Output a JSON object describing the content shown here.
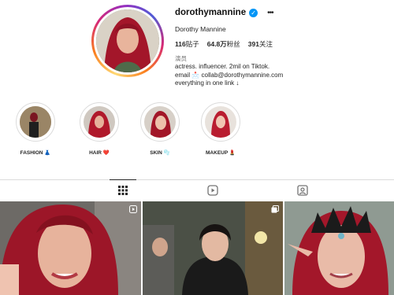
{
  "profile": {
    "username": "dorothymannine",
    "full_name": "Dorothy Mannine",
    "stats": {
      "posts_count": "116",
      "posts_label": "贴子",
      "followers_count": "64.8万",
      "followers_label": "粉丝",
      "following_count": "391",
      "following_label": "关注"
    },
    "category": "演员",
    "bio_lines": [
      "actress. influencer. 2mil on Tiktok.",
      "email 📩 collab@dorothymannine.com",
      "everything in one link ↓"
    ]
  },
  "highlights": [
    {
      "label": "FASHION 👗",
      "icon": "fashion-highlight"
    },
    {
      "label": "HAIR ❤️",
      "icon": "hair-highlight"
    },
    {
      "label": "SKIN 🫧",
      "icon": "skin-highlight"
    },
    {
      "label": "MAKEUP 💄",
      "icon": "makeup-highlight"
    }
  ],
  "tabs": [
    {
      "name": "posts-tab",
      "icon": "grid-icon",
      "active": true
    },
    {
      "name": "reels-tab",
      "icon": "reels-icon",
      "active": false
    },
    {
      "name": "tagged-tab",
      "icon": "tagged-icon",
      "active": false
    }
  ],
  "posts": [
    {
      "type": "reel",
      "badge": "reel-icon"
    },
    {
      "type": "carousel",
      "badge": "carousel-icon"
    },
    {
      "type": "image",
      "badge": ""
    }
  ],
  "colors": {
    "verified": "#0095f6",
    "hair": "#a8182a",
    "text": "#262626",
    "border": "#dbdbdb"
  }
}
